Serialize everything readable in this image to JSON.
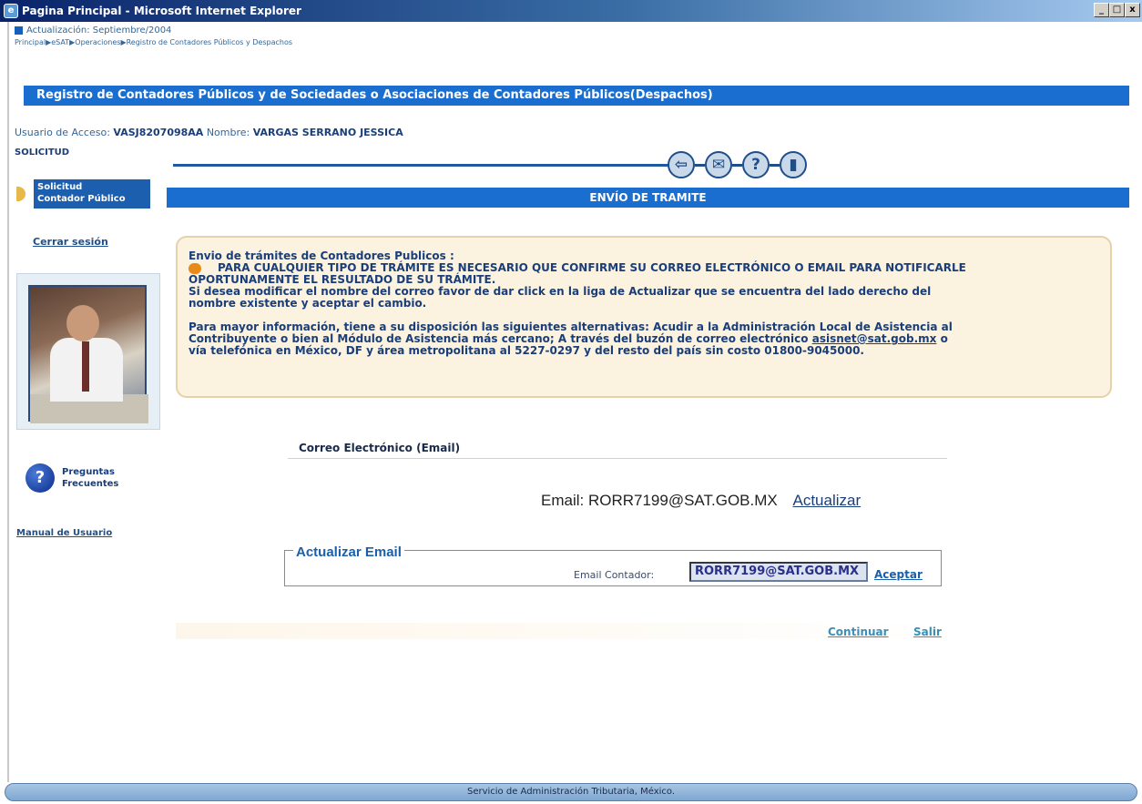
{
  "window": {
    "title": "Pagina Principal - Microsoft Internet Explorer",
    "buttons": [
      "_",
      "□",
      "x"
    ]
  },
  "header": {
    "updated": "Actualización: Septiembre/2004",
    "breadcrumb": "Principal▶eSAT▶Operaciones▶Registro de Contadores Públicos y Despachos",
    "section_title": "Registro de Contadores Públicos y de Sociedades o Asociaciones de Contadores Públicos(Despachos)"
  },
  "user": {
    "access_label": "Usuario de Acceso:",
    "access_value": "VASJ8207098AA",
    "name_label": "Nombre:",
    "name_value": "VARGAS SERRANO JESSICA"
  },
  "sidebar": {
    "section": "SOLICITUD",
    "tab_line1": "Solicitud",
    "tab_line2": "Contador Público",
    "logout": "Cerrar sesión",
    "faq_line1": "Preguntas",
    "faq_line2": "Frecuentes",
    "manual": "Manual de Usuario"
  },
  "nav_icons": [
    "back-icon",
    "mail-icon",
    "help-icon",
    "exit-icon"
  ],
  "main": {
    "bar_title": "ENVÍO DE TRAMITE",
    "info": {
      "heading": "Envio de trámites de Contadores Publicos :",
      "warn_line1": "PARA CUALQUIER TIPO DE TRÁMITE ES NECESARIO QUE CONFIRME SU CORREO ELECTRÓNICO O EMAIL PARA NOTIFICARLE",
      "warn_line2": "OPORTUNAMENTE EL RESULTADO DE SU TRÁMITE.",
      "modify_line1": "Si desea modificar el nombre del correo favor de dar click en la liga de Actualizar que se encuentra del lado derecho del",
      "modify_line2": "nombre existente y aceptar el cambio.",
      "more_line1": "Para mayor información, tiene a su disposición las siguientes alternativas: Acudir a la Administración Local de Asistencia al",
      "more_line2_a": "Contribuyente o bien al Módulo de Asistencia más cercano; A través del buzón de correo electrónico ",
      "more_link": "asisnet@sat.gob.mx",
      "more_line2_b": " o",
      "more_line3": "vía telefónica en México, DF y área metropolitana al 5227-0297 y del resto del país sin costo 01800-9045000."
    },
    "email_header": "Correo Electrónico (Email)",
    "email_label": "Email:",
    "email_value": "RORR7199@SAT.GOB.MX",
    "update_link": "Actualizar",
    "update_box": {
      "legend": "Actualizar Email",
      "field_label": "Email Contador:",
      "field_value": "RORR7199@SAT.GOB.MX",
      "accept": "Aceptar"
    },
    "continue": "Continuar",
    "exit": "Salir"
  },
  "footer": "Servicio de Administración Tributaria, México."
}
